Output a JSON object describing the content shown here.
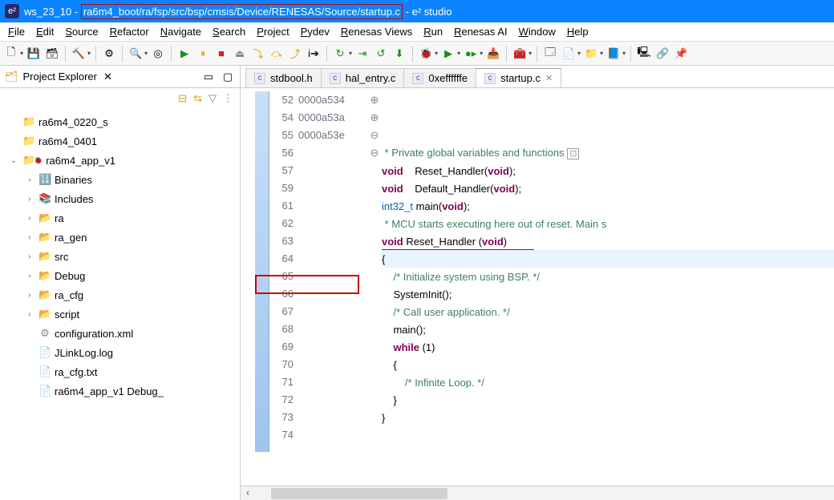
{
  "title": {
    "workspace": "ws_23_10",
    "path": "ra6m4_boot/ra/fsp/src/bsp/cmsis/Device/RENESAS/Source/startup.c",
    "app": "e² studio"
  },
  "menu": [
    "File",
    "Edit",
    "Source",
    "Refactor",
    "Navigate",
    "Search",
    "Project",
    "Pydev",
    "Renesas Views",
    "Run",
    "Renesas AI",
    "Window",
    "Help"
  ],
  "project_explorer": {
    "title": "Project Explorer",
    "items": [
      {
        "indent": 0,
        "tw": "",
        "icon": "📁",
        "color": "#7aa7d8",
        "label": "ra6m4_0220_s"
      },
      {
        "indent": 0,
        "tw": "",
        "icon": "📁",
        "color": "#7aa7d8",
        "label": "ra6m4_0401"
      },
      {
        "indent": 0,
        "tw": "v",
        "icon": "📁",
        "color": "#d89c3a",
        "label": "ra6m4_app_v1",
        "deco": "🐞"
      },
      {
        "indent": 1,
        "tw": ">",
        "icon": "🔢",
        "color": "#6b6bd6",
        "label": "Binaries"
      },
      {
        "indent": 1,
        "tw": ">",
        "icon": "📚",
        "color": "#6b6bd6",
        "label": "Includes"
      },
      {
        "indent": 1,
        "tw": ">",
        "icon": "📂",
        "color": "#d89c3a",
        "label": "ra"
      },
      {
        "indent": 1,
        "tw": ">",
        "icon": "📂",
        "color": "#d89c3a",
        "label": "ra_gen"
      },
      {
        "indent": 1,
        "tw": ">",
        "icon": "📂",
        "color": "#d89c3a",
        "label": "src"
      },
      {
        "indent": 1,
        "tw": ">",
        "icon": "📂",
        "color": "#d89c3a",
        "label": "Debug"
      },
      {
        "indent": 1,
        "tw": ">",
        "icon": "📂",
        "color": "#d89c3a",
        "label": "ra_cfg"
      },
      {
        "indent": 1,
        "tw": ">",
        "icon": "📂",
        "color": "#d89c3a",
        "label": "script"
      },
      {
        "indent": 1,
        "tw": "",
        "icon": "⚙",
        "color": "#888",
        "label": "configuration.xml"
      },
      {
        "indent": 1,
        "tw": "",
        "icon": "📄",
        "color": "#888",
        "label": "JLinkLog.log"
      },
      {
        "indent": 1,
        "tw": "",
        "icon": "📄",
        "color": "#888",
        "label": "ra_cfg.txt"
      },
      {
        "indent": 1,
        "tw": "",
        "icon": "📄",
        "color": "#888",
        "label": "ra6m4_app_v1 Debug_"
      }
    ]
  },
  "tabs": [
    {
      "label": "stdbool.h",
      "active": false
    },
    {
      "label": "hal_entry.c",
      "active": false
    },
    {
      "label": "0xeffffffe",
      "active": false
    },
    {
      "label": "startup.c",
      "active": true
    }
  ],
  "code": {
    "lines": [
      {
        "n": 52,
        "fold": "⊕",
        "html": " * Private global variables and functions",
        "cls": "cm",
        "box": true
      },
      {
        "n": 54,
        "html": "<span class='kw'>void</span>    <span class='fn'>Reset_Handler</span>(<span class='kw'>void</span>);"
      },
      {
        "n": 55,
        "html": "<span class='kw'>void</span>    <span class='fn'>Default_Handler</span>(<span class='kw'>void</span>);"
      },
      {
        "n": 56,
        "html": "<span class='ty'>int32_t</span> <span class='fn'>main</span>(<span class='kw'>void</span>);"
      },
      {
        "n": 57,
        "html": ""
      },
      {
        "n": 59,
        "fold": "⊕",
        "html": " * MCU starts executing here out of reset. Main s",
        "cls": "cm"
      },
      {
        "n": 61,
        "fold": "⊖",
        "html": "<span class='kw'>void</span> <span class='fn'>Reset_Handler</span> (<span class='kw'>void</span>)"
      },
      {
        "n": 62,
        "html": "{"
      },
      {
        "n": 63,
        "html": "    <span class='cm'>/* Initialize system using BSP. */</span>"
      },
      {
        "n": 64,
        "addr": "0000a534",
        "html": "    SystemInit();",
        "cur": true,
        "arrow": true
      },
      {
        "n": 65,
        "html": ""
      },
      {
        "n": 66,
        "html": "    <span class='cm'>/* Call user application. */</span>"
      },
      {
        "n": 67,
        "addr": "0000a53a",
        "html": "    main();"
      },
      {
        "n": 68,
        "html": ""
      },
      {
        "n": 69,
        "addr": "0000a53e",
        "fold": "⊖",
        "html": "    <span class='kw'>while</span> (1)"
      },
      {
        "n": 70,
        "html": "    {"
      },
      {
        "n": 71,
        "html": "        <span class='cm'>/* Infinite Loop. */</span>"
      },
      {
        "n": 72,
        "html": "    }"
      },
      {
        "n": 73,
        "html": "}"
      },
      {
        "n": 74,
        "html": ""
      }
    ]
  }
}
